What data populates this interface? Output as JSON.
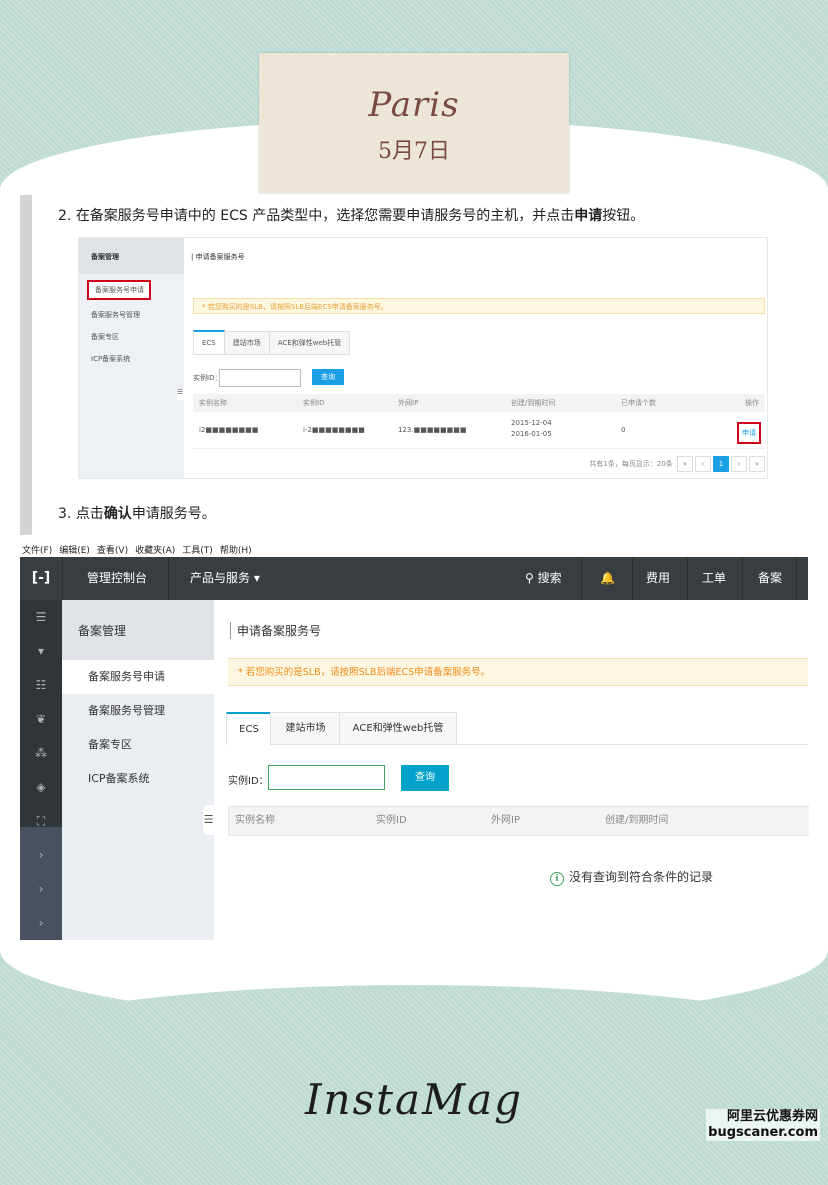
{
  "cover": {
    "title": "Paris",
    "date": "5月7日"
  },
  "steps": {
    "step2": {
      "num": "2.",
      "pre": "在备案服务号申请中的 ECS 产品类型中，选择您需要申请服务号的主机，并点击",
      "bold": "申请",
      "post": "按钮。"
    },
    "step3": {
      "num": "3.",
      "pre": "点击",
      "bold": "确认",
      "post": "申请服务号。"
    }
  },
  "small_ss": {
    "sidebar_head": "备案管理",
    "sidebar_items": [
      "备案服务号申请",
      "备案服务号管理",
      "备案专区",
      "ICP备案系统"
    ],
    "page_title": "申请备案服务号",
    "notice": "* 若您购买的是SLB，请按照SLB后端ECS申请备案服务号。",
    "tabs": [
      "ECS",
      "建站市场",
      "ACE和弹性web托管"
    ],
    "instance_label": "实例ID：",
    "query_btn": "查询",
    "columns": [
      "实例名称",
      "实例ID",
      "外网IP",
      "创建/到期时间",
      "已申请个数",
      "操作"
    ],
    "row": {
      "name": "i2■■■■■■■■",
      "id": "i-2■■■■■■■■",
      "ip": "123.■■■■■■■■",
      "created": "2015-12-04",
      "expires": "2016-01-05",
      "count": "0",
      "action": "申请"
    },
    "pager_text": "共有1条，每页显示：20条",
    "pager_buttons": [
      "«",
      "‹",
      "1",
      "›",
      "»"
    ]
  },
  "menubar": [
    "文件(F)",
    "编辑(E)",
    "查看(V)",
    "收藏夹(A)",
    "工具(T)",
    "帮助(H)"
  ],
  "topbar": {
    "logo": "[-]",
    "console": "管理控制台",
    "products": "产品与服务 ▾",
    "search": "搜索",
    "bell": "🔔",
    "fees": "费用",
    "ticket": "工单",
    "beian": "备案"
  },
  "leftnav_icons": [
    "☰",
    "▾",
    "☷",
    "❦",
    "⁂",
    "◈",
    "⛶",
    "›",
    "›",
    "›"
  ],
  "side2": {
    "head": "备案管理",
    "items": [
      "备案服务号申请",
      "备案服务号管理",
      "备案专区",
      "ICP备案系统"
    ]
  },
  "main": {
    "title": "申请备案服务号",
    "notice": "* 若您购买的是SLB，请按照SLB后端ECS申请备案服务号。",
    "tabs": [
      "ECS",
      "建站市场",
      "ACE和弹性web托管"
    ],
    "instance_label": "实例ID：",
    "query_btn": "查询",
    "columns": [
      "实例名称",
      "实例ID",
      "外网IP",
      "创建/到期时间"
    ],
    "empty_icon": "i",
    "empty": "没有查询到符合条件的记录"
  },
  "footer": {
    "brand": "InstaMag",
    "watermark1": "阿里云优惠券网",
    "watermark2": "bugscaner.com"
  }
}
